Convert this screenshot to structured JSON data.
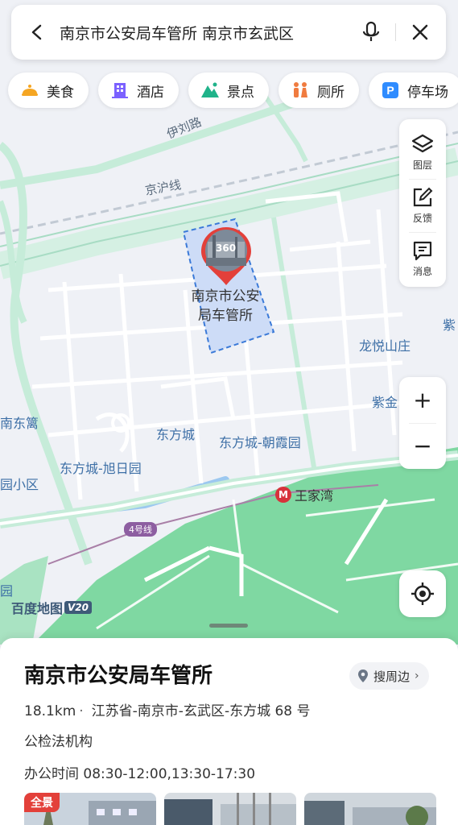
{
  "search": {
    "query": "南京市公安局车管所 南京市玄武区",
    "back_icon": "chevron-left-icon",
    "mic_icon": "microphone-icon",
    "close_icon": "close-icon"
  },
  "categories": [
    {
      "label": "美食",
      "icon": "food-icon",
      "color": "#f5a623"
    },
    {
      "label": "酒店",
      "icon": "hotel-icon",
      "color": "#7b61ff"
    },
    {
      "label": "景点",
      "icon": "scenic-icon",
      "color": "#20b38a"
    },
    {
      "label": "厕所",
      "icon": "toilet-icon",
      "color": "#f07b3f"
    },
    {
      "label": "停车场",
      "icon": "parking-icon",
      "color": "#2f8cff"
    }
  ],
  "tools": [
    {
      "label": "图层",
      "icon": "layers-icon"
    },
    {
      "label": "反馈",
      "icon": "edit-feedback-icon"
    },
    {
      "label": "消息",
      "icon": "message-icon"
    }
  ],
  "map": {
    "labels": {
      "poi": "南京市公安局车管所",
      "poi_line1": "南京市公安",
      "poi_line2": "局车管所",
      "pano": "360",
      "road_yiliu": "伊刘路",
      "rail_jinghu": "京沪线",
      "longyue": "龙悦山庄",
      "zi_right": "紫",
      "zijin": "紫金",
      "dongfangcheng": "东方城",
      "zhaoxiayuan": "东方城-朝霞园",
      "xuriyuan": "东方城-旭日园",
      "nandong": "南东篱",
      "xiaoqu": "园小区",
      "yuan": "园",
      "metro_station": "王家湾",
      "metro_line": "4号线"
    },
    "logo": "百度地图",
    "logo_version": "V20",
    "colors": {
      "park": "#7fd8a2",
      "road": "#ffffff",
      "highway": "#c6ecd9",
      "poi_area": "#cddcf7",
      "poi_border": "#3b7ad8",
      "water": "#9cc8f0",
      "marker": "#e3403a"
    }
  },
  "controls": {
    "zoom_in": "+",
    "zoom_out": "−",
    "locate_icon": "locate-icon"
  },
  "place": {
    "name": "南京市公安局车管所",
    "nearby_label": "搜周边",
    "distance": "18.1km",
    "address": "江苏省-南京市-玄武区-东方城 68 号",
    "category": "公检法机构",
    "hours": "办公时间 08:30-12:00,13:30-17:30",
    "photo_badge": "全景"
  }
}
